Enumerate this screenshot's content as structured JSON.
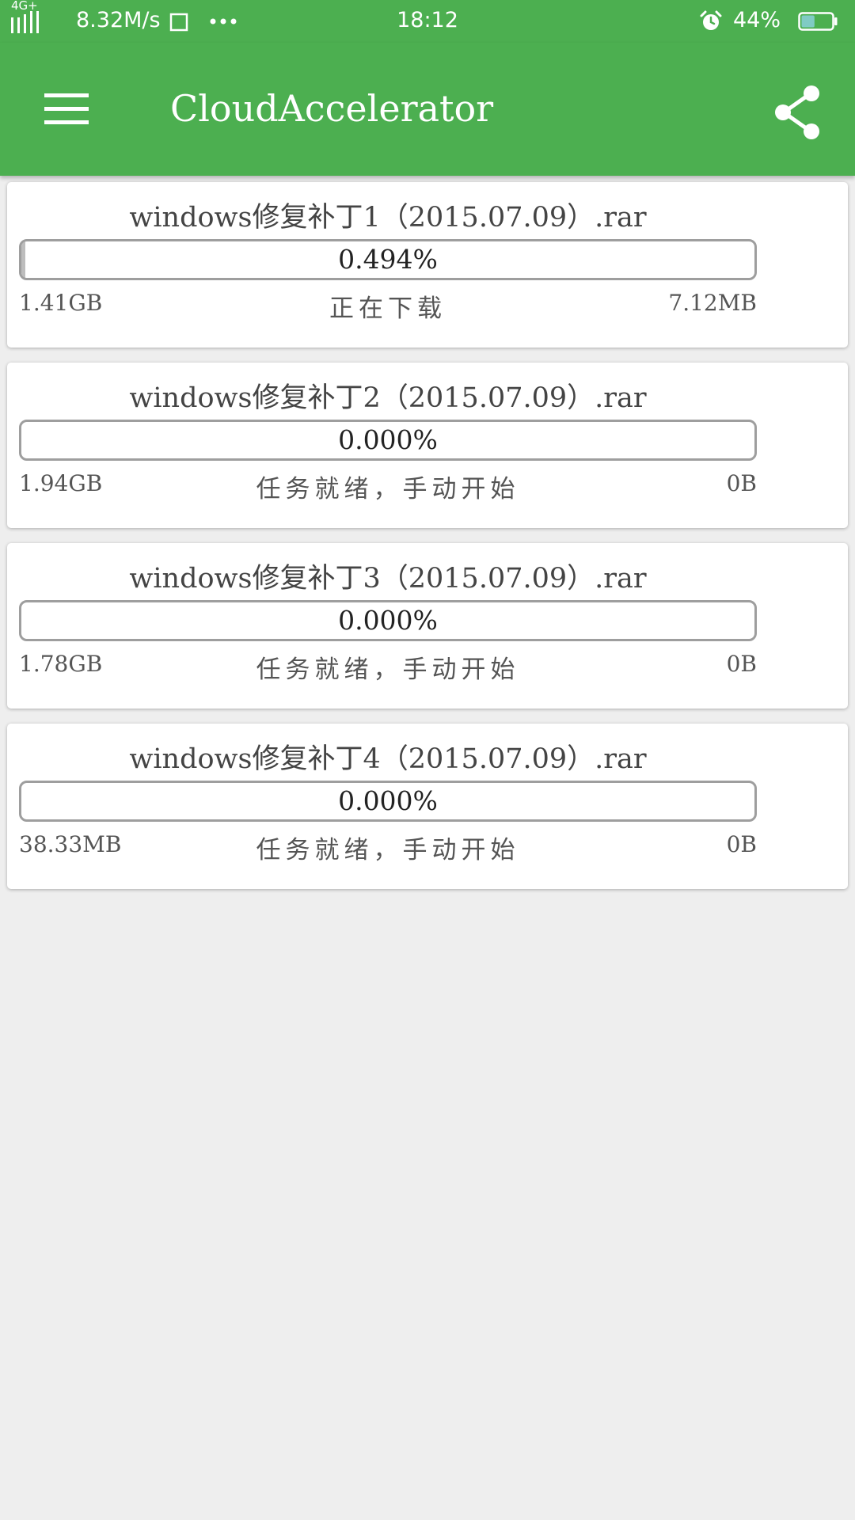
{
  "status_bar": {
    "network_type": "4G+",
    "net_speed": "8.32M/s",
    "time": "18:12",
    "battery_percent": "44%",
    "battery_level": 0.44,
    "icons": [
      "signal-icon",
      "screenshot-icon",
      "more-dots-icon",
      "alarm-icon",
      "battery-icon"
    ]
  },
  "app_bar": {
    "title": "CloudAccelerator",
    "background_color": "#4caf50",
    "menu_icon": "hamburger-menu-icon",
    "share_icon": "share-icon"
  },
  "downloads": [
    {
      "filename": "windows修复补丁1（2015.07.09）.rar",
      "progress_text": "0.494%",
      "progress_fraction": 0.00494,
      "total_size": "1.41GB",
      "status": "正在下载",
      "downloaded": "7.12MB"
    },
    {
      "filename": "windows修复补丁2（2015.07.09）.rar",
      "progress_text": "0.000%",
      "progress_fraction": 0,
      "total_size": "1.94GB",
      "status": "任务就绪，手动开始",
      "downloaded": "0B"
    },
    {
      "filename": "windows修复补丁3（2015.07.09）.rar",
      "progress_text": "0.000%",
      "progress_fraction": 0,
      "total_size": "1.78GB",
      "status": "任务就绪，手动开始",
      "downloaded": "0B"
    },
    {
      "filename": "windows修复补丁4（2015.07.09）.rar",
      "progress_text": "0.000%",
      "progress_fraction": 0,
      "total_size": "38.33MB",
      "status": "任务就绪，手动开始",
      "downloaded": "0B"
    }
  ]
}
